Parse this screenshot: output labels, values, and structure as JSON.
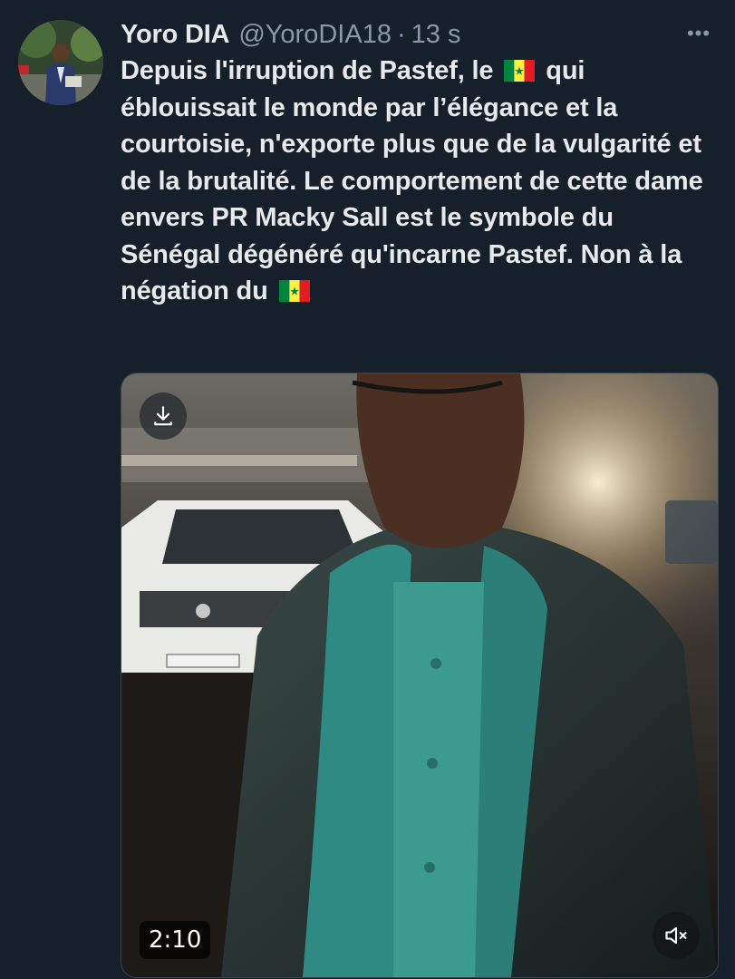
{
  "tweet": {
    "author_name": "Yoro DIA",
    "handle": "@YoroDIA18",
    "separator": "·",
    "time": "13 s",
    "more_label": "•••",
    "text_segments": [
      "Depuis l'irruption de Pastef, le",
      "qui éblouissait le monde par l’élégance et la courtoisie, n'exporte plus que de la vulgarité et de la brutalité. Le comportement de cette dame envers PR Macky  Sall est le symbole du Sénégal dégénéré qu'incarne Pastef. Non à la négation du"
    ],
    "flag_icon": "senegal-flag-emoji"
  },
  "media": {
    "duration": "2:10",
    "download_icon": "download-icon",
    "mute_icon": "muted-speaker-icon"
  },
  "colors": {
    "background": "#15202b",
    "text_primary": "#e7e9ea",
    "text_secondary": "#8b98a5",
    "flag_green": "#00853f",
    "flag_yellow": "#fdef42",
    "flag_red": "#e31b23"
  }
}
